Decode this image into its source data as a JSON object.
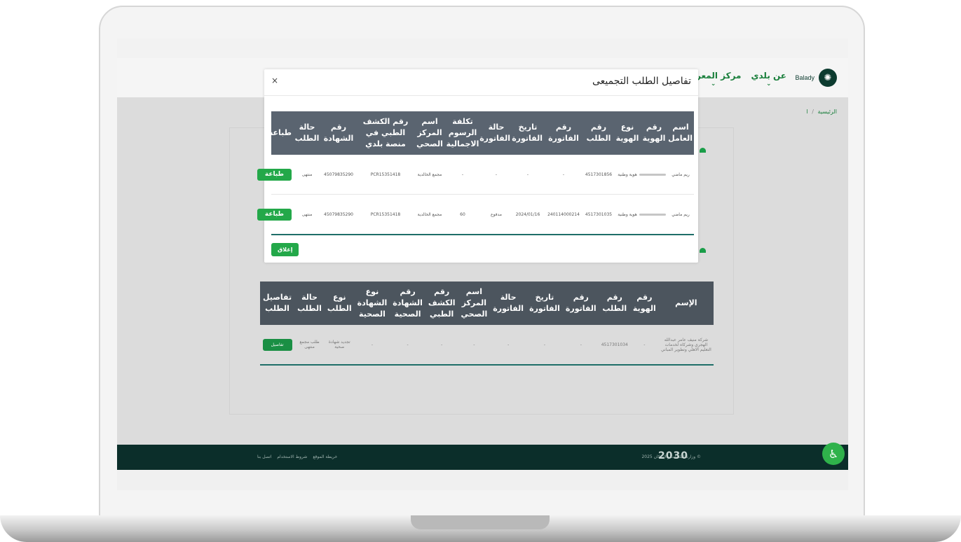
{
  "header": {
    "logo_label": "Balady",
    "nav": [
      {
        "label": "عن بلدي"
      },
      {
        "label": "مركز المعرفة"
      }
    ]
  },
  "breadcrumb": {
    "home": "الرئيسية",
    "current": "ا"
  },
  "modal": {
    "title": "تفاصيل الطلب التجميعى",
    "close_icon": "×",
    "columns": [
      "اسم العامل",
      "رقم الهوية",
      "نوع الهوية",
      "رقم الطلب",
      "رقم الفاتورة",
      "تاريخ الفاتورة",
      "حالة الفاتورة",
      "تكلفة الرسوم الاجمالية",
      "اسم المركز الصحي",
      "رقم الكشف الطبي في منصة بلدي",
      "رقم الشهادة",
      "حالة الطلب",
      "طباعة"
    ],
    "rows": [
      {
        "name": "ريم ماضي",
        "id_type": "هوية وطنية",
        "request_no": "4517301856",
        "invoice_no": "-",
        "invoice_date": "-",
        "invoice_status": "-",
        "total_fees": "-",
        "center": "مجمع الخالدية",
        "exam_no": "PCR15351418",
        "certificate_no": "45079835290",
        "status": "منتهى",
        "print": "طباعة"
      },
      {
        "name": "ريم ماضي",
        "id_type": "هوية وطنية",
        "request_no": "4517301035",
        "invoice_no": "240114000214",
        "invoice_date": "2024/01/16",
        "invoice_status": "مدفوع",
        "total_fees": "60",
        "center": "مجمع الخالدية",
        "exam_no": "PCR15351418",
        "certificate_no": "45079835290",
        "status": "منتهى",
        "print": "طباعة"
      }
    ],
    "close_button": "إغلاق"
  },
  "bg_table": {
    "columns": [
      "الإسم",
      "رقم الهوية",
      "رقم الطلب",
      "رقم الفاتورة",
      "تاريخ الفاتورة",
      "حالة الفاتورة",
      "اسم المركز الصحي",
      "رقم الكشف الطبي",
      "رقم الشهادة الصحية",
      "نوع الشهادة الصحية",
      "نوع الطلب",
      "حالة الطلب",
      "تفاصيل الطلب"
    ],
    "row": {
      "name": "شركة منيف عامر عبدالله الهجري وشركاه لخدمات التعليم الاهلي وتطوير المباني",
      "id": "-",
      "request_no": "4517301034",
      "invoice_no": "-",
      "invoice_date": "-",
      "invoice_status": "-",
      "center": "-",
      "exam_no": "-",
      "cert_no": "-",
      "cert_type": "-",
      "request_type": "تجديد شهادة صحية",
      "status": "طلب مجمع منتهى",
      "details": "تفاصيل"
    }
  },
  "footer": {
    "links": [
      "خريطة الموقع",
      "شروط الاستخدام",
      "اتصل بنا"
    ],
    "copyright": "© وزارة البلديات والإسكان 2025",
    "vision": "2030"
  },
  "accessibility_icon": "accessibility-icon"
}
